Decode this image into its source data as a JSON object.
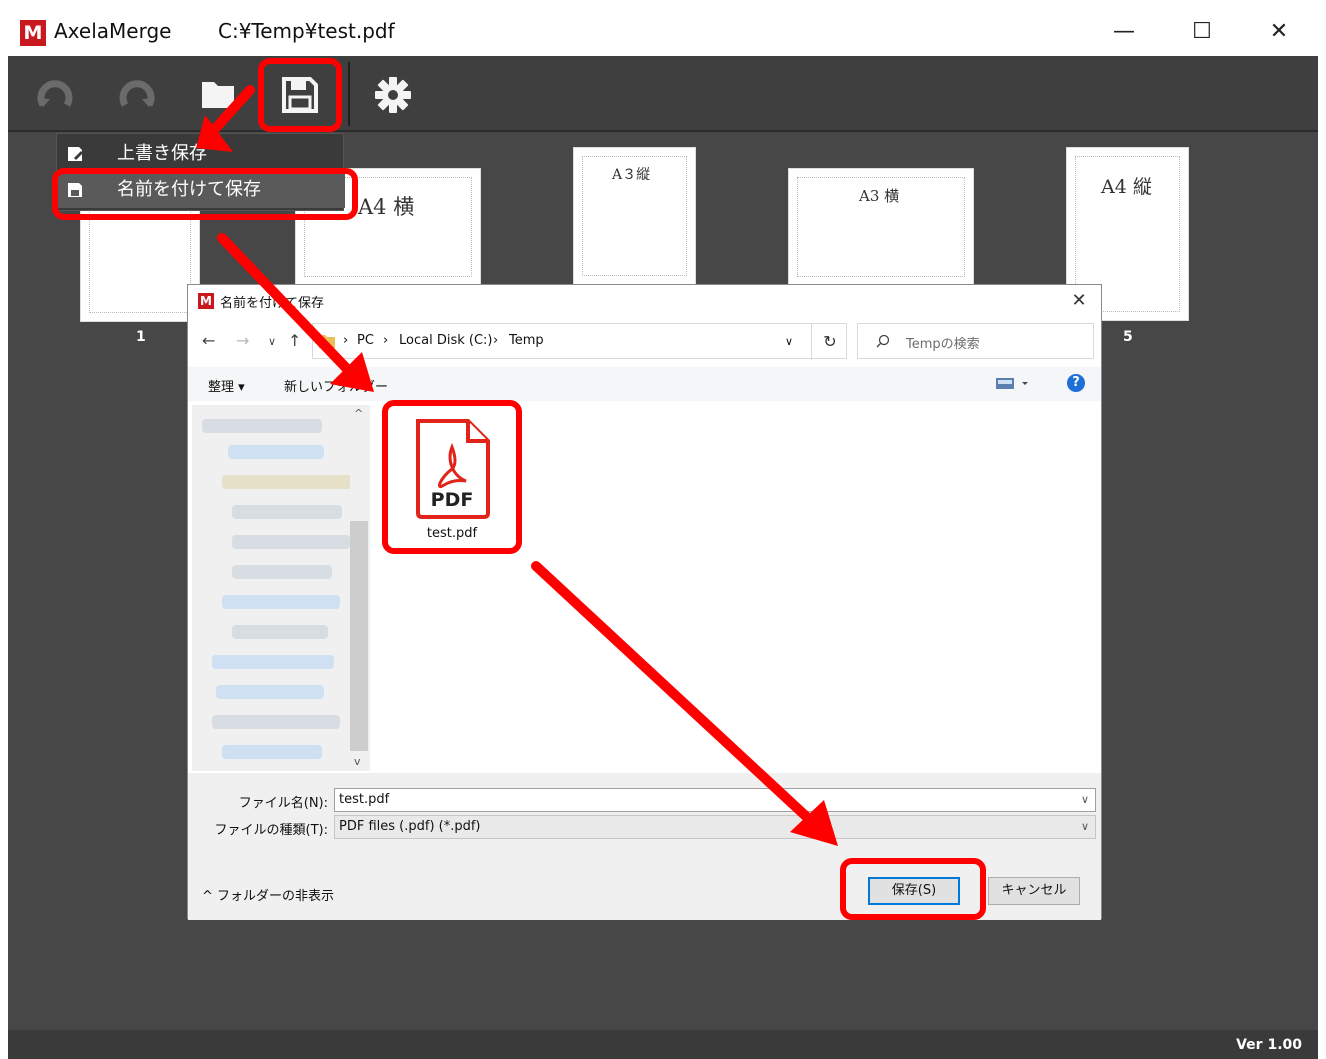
{
  "window": {
    "logo_letter": "M",
    "app_name": "AxelaMerge",
    "file_path": "C:¥Temp¥test.pdf",
    "minimize": "—",
    "maximize": "☐",
    "close": "✕"
  },
  "toolbar": {
    "icons": [
      "rotate-left-icon",
      "rotate-right-icon",
      "folder-open-icon",
      "save-icon",
      "gear-icon"
    ]
  },
  "menu": {
    "items": [
      {
        "label": "上書き保存",
        "icon": "overwrite-save-icon"
      },
      {
        "label": "名前を付けて保存",
        "icon": "save-as-icon"
      }
    ]
  },
  "thumbnails": [
    {
      "label": "",
      "number": "1"
    },
    {
      "label": "A4 横",
      "number": ""
    },
    {
      "label": "A３縦",
      "number": ""
    },
    {
      "label": "A3 横",
      "number": ""
    },
    {
      "label": "A4 縦",
      "number": "5"
    }
  ],
  "dialog": {
    "logo_letter": "M",
    "title": "名前を付けて保存",
    "close": "✕",
    "nav": {
      "back": "←",
      "forward": "→",
      "history": "∨",
      "up": "↑"
    },
    "breadcrumb": [
      "PC",
      "Local Disk (C:)",
      "Temp"
    ],
    "refresh": "↻",
    "search_placeholder": "Tempの検索",
    "commands": {
      "organize": "整理 ▾",
      "new_folder": "新しいフォルダー"
    },
    "help": "?",
    "file": {
      "type_badge": "PDF",
      "name": "test.pdf"
    },
    "filename_label": "ファイル名(N):",
    "filename_value": "test.pdf",
    "filetype_label": "ファイルの種類(T):",
    "filetype_value": "PDF files (.pdf) (*.pdf)",
    "hide_folders": "フォルダーの非表示",
    "save_button": "保存(S)",
    "cancel_button": "キャンセル"
  },
  "status": {
    "version": "Ver 1.00"
  },
  "colors": {
    "accent_red": "#c8191f",
    "annotation_red": "#ff0000",
    "app_bg": "#474747"
  }
}
